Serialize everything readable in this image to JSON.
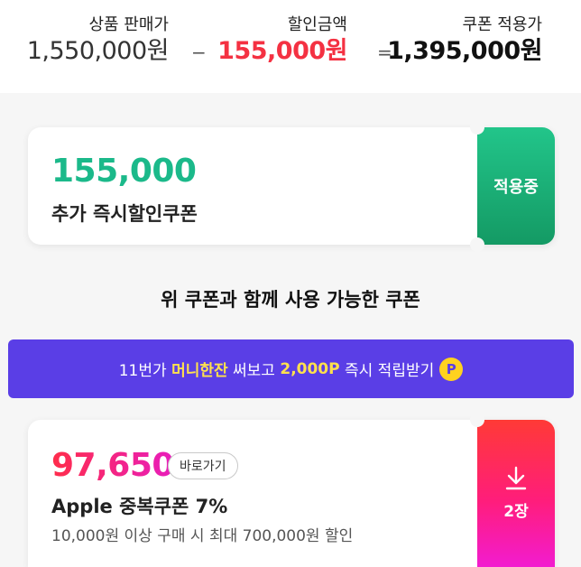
{
  "summary": {
    "original": {
      "label": "상품 판매가",
      "value": "1,550,000원"
    },
    "minus": "−",
    "discount": {
      "label": "할인금액",
      "value": "155,000원"
    },
    "equals": "=",
    "final": {
      "label": "쿠폰 적용가",
      "value": "1,395,000원"
    }
  },
  "coupon_applied": {
    "amount": "155,000",
    "name": "추가 즉시할인쿠폰",
    "status": "적용중",
    "accent_color": "#1bb98a"
  },
  "section_title": "위 쿠폰과 함께 사용 가능한 쿠폰",
  "banner": {
    "prefix": "11번가 ",
    "highlight": "머니한잔",
    "middle": " 써보고 ",
    "points": "2,000P",
    "suffix": " 즉시 적립받기",
    "coin_symbol": "P",
    "background": "#5a3ee6"
  },
  "coupon_extra": {
    "amount": "97,650",
    "shortcut_label": "바로가기",
    "name": "Apple 중복쿠폰 7%",
    "desc": "10,000원 이상 구매 시 최대 700,000원 할인",
    "download_icon": "download-icon",
    "count": "2장"
  }
}
